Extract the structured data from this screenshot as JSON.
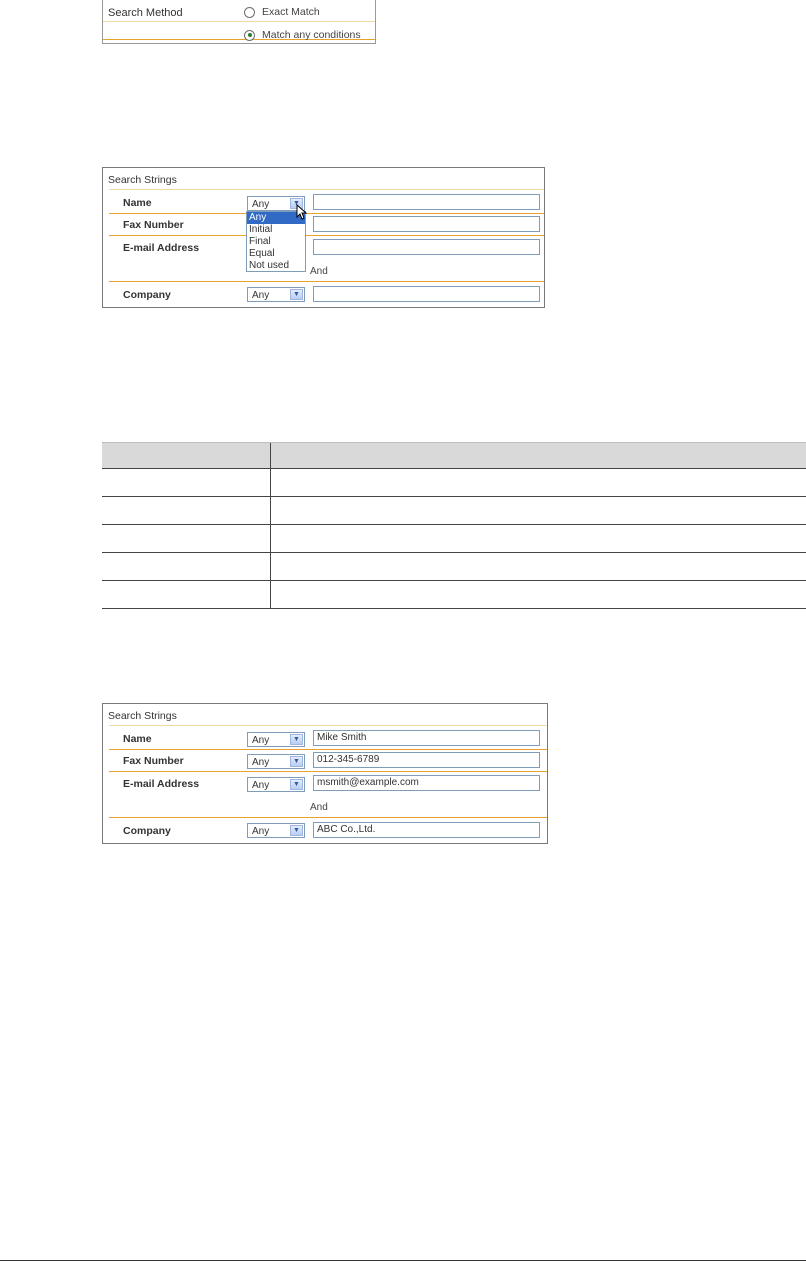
{
  "search_method": {
    "label": "Search Method",
    "options": [
      {
        "label": "Exact Match",
        "checked": false
      },
      {
        "label": "Match any conditions",
        "checked": true
      }
    ]
  },
  "panel1": {
    "title": "Search Strings",
    "rows": [
      {
        "label": "Name",
        "select": "Any",
        "value": ""
      },
      {
        "label": "Fax Number",
        "select": "",
        "value": ""
      },
      {
        "label": "E-mail Address",
        "select": "",
        "value": ""
      },
      {
        "label": "Company",
        "select": "Any",
        "value": ""
      }
    ],
    "and_label": "And",
    "dropdown_options": [
      "Any",
      "Initial",
      "Final",
      "Equal",
      "Not used"
    ],
    "dropdown_selected": "Any"
  },
  "table": {
    "headers": [
      "",
      ""
    ],
    "rows": [
      [
        "",
        ""
      ],
      [
        "",
        ""
      ],
      [
        "",
        ""
      ],
      [
        "",
        ""
      ],
      [
        "",
        ""
      ]
    ]
  },
  "panel2": {
    "title": "Search Strings",
    "rows": [
      {
        "label": "Name",
        "select": "Any",
        "value": "Mike Smith"
      },
      {
        "label": "Fax Number",
        "select": "Any",
        "value": "012-345-6789"
      },
      {
        "label": "E-mail Address",
        "select": "Any",
        "value": "msmith@example.com"
      },
      {
        "label": "Company",
        "select": "Any",
        "value": "ABC Co.,Ltd."
      }
    ],
    "and_label": "And"
  },
  "colors": {
    "accent_line": "#e8a32a",
    "selection": "#316ac5",
    "input_border": "#7f9db9",
    "radio_dot": "#2d7c2d"
  }
}
